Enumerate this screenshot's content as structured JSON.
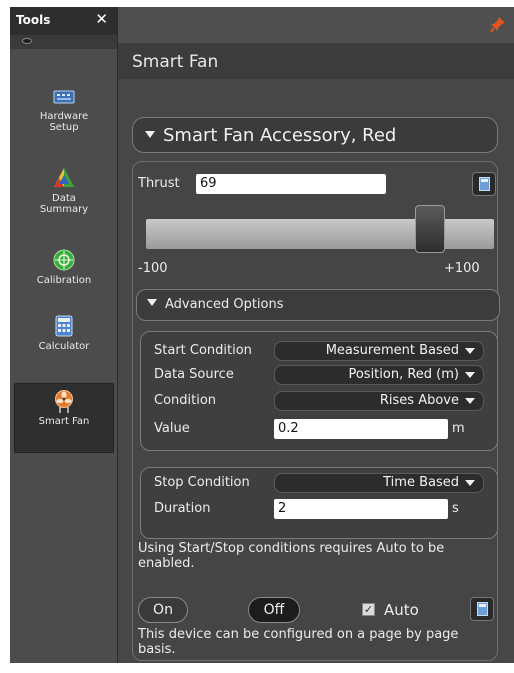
{
  "tools": {
    "title": "Tools",
    "close_glyph": "✕",
    "items": [
      {
        "label": "Hardware\nSetup",
        "icon": "hardware-setup-icon"
      },
      {
        "label": "Data\nSummary",
        "icon": "data-summary-icon"
      },
      {
        "label": "Calibration",
        "icon": "calibration-icon"
      },
      {
        "label": "Calculator",
        "icon": "calculator-icon"
      },
      {
        "label": "Smart Fan",
        "icon": "smart-fan-icon"
      }
    ]
  },
  "panel": {
    "title": "Smart Fan",
    "accessory": "Smart Fan Accessory, Red",
    "thrust_label": "Thrust",
    "thrust_value": "69",
    "slider_min_label": "-100",
    "slider_max_label": "+100",
    "slider_min": -100,
    "slider_max": 100,
    "slider_value": 69,
    "advanced_label": "Advanced Options",
    "start": {
      "condition_label": "Start Condition",
      "condition_value": "Measurement Based",
      "source_label": "Data Source",
      "source_value": "Position, Red (m)",
      "cond_label": "Condition",
      "cond_value": "Rises Above",
      "value_label": "Value",
      "value": "0.2",
      "value_unit": "m"
    },
    "stop": {
      "condition_label": "Stop Condition",
      "condition_value": "Time Based",
      "duration_label": "Duration",
      "duration_value": "2",
      "duration_unit": "s"
    },
    "note": "Using Start/Stop conditions requires Auto to be enabled.",
    "on_label": "On",
    "off_label": "Off",
    "auto_label": "Auto",
    "auto_checked": true,
    "footer_note": "This device can be configured on a page by page basis."
  },
  "colors": {
    "pin": "#e0561b",
    "panel_bg": "#474747",
    "tools_bg": "#4c4c4c"
  }
}
